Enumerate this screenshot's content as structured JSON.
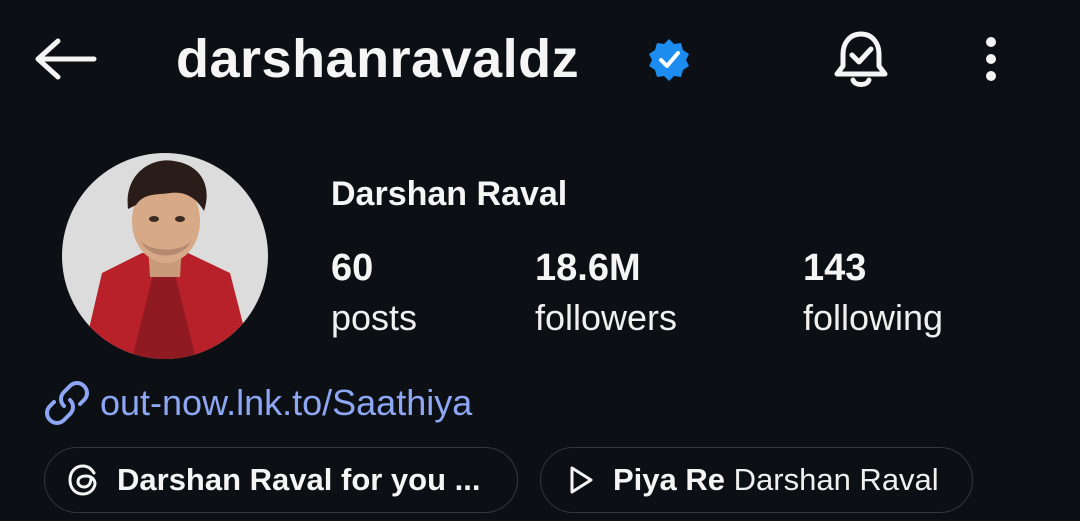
{
  "header": {
    "username": "darshanravaldz",
    "back_icon": "arrow-left-icon",
    "verified_icon": "verified-badge-icon",
    "notifications_icon": "bell-check-icon",
    "more_icon": "more-vertical-icon"
  },
  "profile": {
    "full_name": "Darshan Raval",
    "avatar_icon": "profile-photo",
    "stats": {
      "posts": {
        "value": "60",
        "label": "posts"
      },
      "followers": {
        "value": "18.6M",
        "label": "followers"
      },
      "following": {
        "value": "143",
        "label": "following"
      }
    },
    "link": {
      "icon": "link-icon",
      "text": "out-now.lnk.to/Saathiya"
    },
    "chips": [
      {
        "icon": "threads-icon",
        "title": "Darshan Raval for you ...",
        "subtitle": ""
      },
      {
        "icon": "play-icon",
        "title": "Piya Re",
        "subtitle": "Darshan Raval"
      }
    ]
  },
  "colors": {
    "background": "#0c0f14",
    "text": "#f5f5f5",
    "link": "#8ea7f5",
    "verified": "#1d8cf0",
    "chip_border": "#33363c"
  }
}
